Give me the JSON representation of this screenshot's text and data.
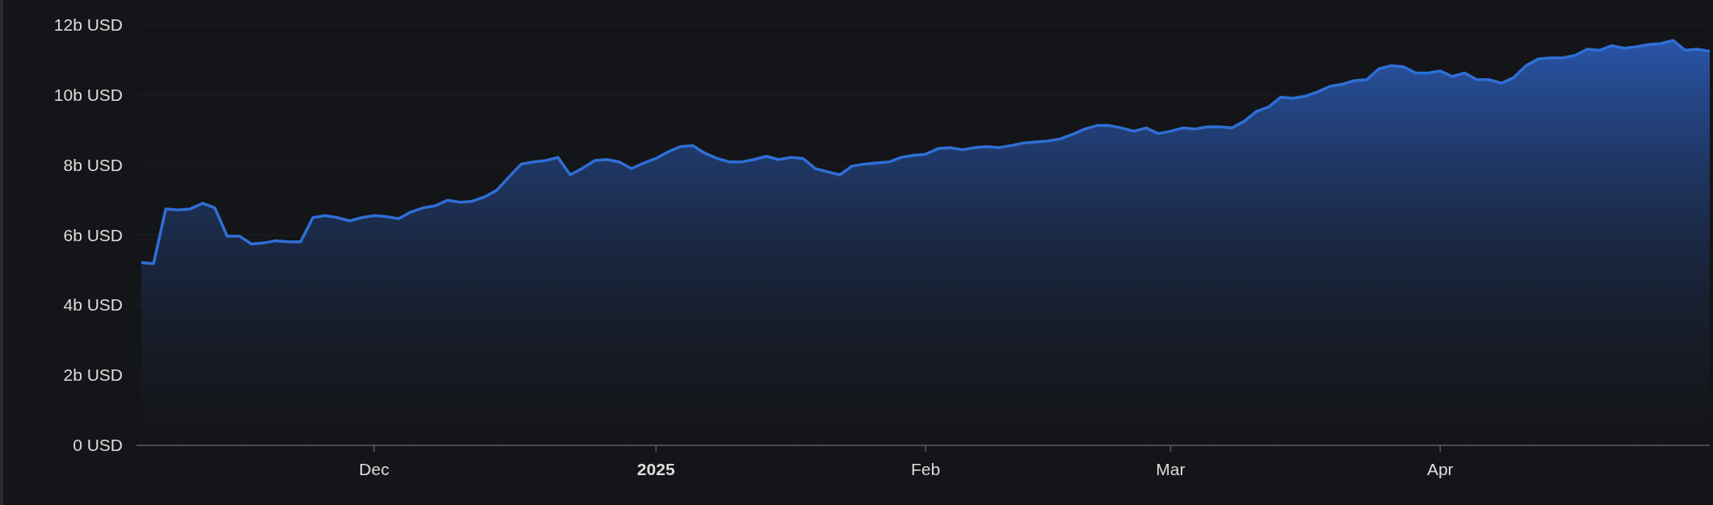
{
  "chart": {
    "chart_data": {
      "type": "area",
      "grid": true,
      "ylim": [
        0,
        12
      ],
      "categories": [
        null,
        null,
        null,
        null,
        null,
        null,
        null,
        null,
        null,
        null,
        null,
        null,
        null,
        null,
        null,
        null,
        null,
        null,
        null,
        "Dec",
        null,
        null,
        null,
        null,
        null,
        null,
        null,
        null,
        null,
        null,
        null,
        null,
        null,
        null,
        null,
        null,
        null,
        null,
        null,
        null,
        null,
        null,
        "2025",
        null,
        null,
        null,
        null,
        null,
        null,
        null,
        null,
        null,
        null,
        null,
        null,
        null,
        null,
        null,
        null,
        null,
        null,
        null,
        null,
        null,
        "Feb",
        null,
        null,
        null,
        null,
        null,
        null,
        null,
        null,
        null,
        null,
        null,
        null,
        null,
        null,
        null,
        null,
        null,
        null,
        null,
        "Mar",
        null,
        null,
        null,
        null,
        null,
        null,
        null,
        null,
        null,
        null,
        null,
        null,
        null,
        null,
        null,
        null,
        null,
        null,
        null,
        null,
        null,
        "Apr",
        null,
        null,
        null,
        null,
        null,
        null,
        null,
        null,
        null,
        null,
        null,
        null,
        null,
        null,
        null,
        null,
        null,
        null,
        null,
        null,
        null,
        null
      ],
      "yticks": [
        {
          "value": 0,
          "label": "0 USD"
        },
        {
          "value": 2,
          "label": "2b USD"
        },
        {
          "value": 4,
          "label": "4b USD"
        },
        {
          "value": 6,
          "label": "6b USD"
        },
        {
          "value": 8,
          "label": "8b USD"
        },
        {
          "value": 10,
          "label": "10b USD"
        },
        {
          "value": 12,
          "label": "12b USD"
        }
      ],
      "series": [
        {
          "color": "#2f6fd6",
          "values": [
            5.22,
            5.19,
            6.75,
            6.72,
            6.75,
            6.91,
            6.78,
            5.97,
            5.97,
            5.75,
            5.78,
            5.84,
            5.81,
            5.81,
            6.5,
            6.56,
            6.5,
            6.41,
            6.5,
            6.56,
            6.53,
            6.47,
            6.66,
            6.78,
            6.84,
            7.0,
            6.94,
            6.97,
            7.09,
            7.28,
            7.66,
            8.03,
            8.09,
            8.13,
            8.22,
            7.72,
            7.91,
            8.13,
            8.16,
            8.09,
            7.9,
            8.06,
            8.19,
            8.38,
            8.53,
            8.56,
            8.34,
            8.19,
            8.09,
            8.09,
            8.16,
            8.25,
            8.16,
            8.22,
            8.19,
            7.9,
            7.81,
            7.72,
            7.97,
            8.03,
            8.06,
            8.09,
            8.22,
            8.28,
            8.31,
            8.47,
            8.5,
            8.44,
            8.5,
            8.53,
            8.5,
            8.56,
            8.63,
            8.66,
            8.69,
            8.75,
            8.88,
            9.03,
            9.13,
            9.13,
            9.06,
            8.97,
            9.06,
            8.9,
            8.97,
            9.06,
            9.03,
            9.09,
            9.09,
            9.06,
            9.25,
            9.53,
            9.66,
            9.94,
            9.91,
            9.97,
            10.09,
            10.25,
            10.31,
            10.41,
            10.44,
            10.75,
            10.84,
            10.81,
            10.63,
            10.63,
            10.69,
            10.53,
            10.63,
            10.44,
            10.44,
            10.34,
            10.5,
            10.84,
            11.03,
            11.06,
            11.06,
            11.13,
            11.31,
            11.28,
            11.41,
            11.34,
            11.38,
            11.44,
            11.47,
            11.56,
            11.28,
            11.31,
            11.25
          ]
        }
      ]
    }
  }
}
